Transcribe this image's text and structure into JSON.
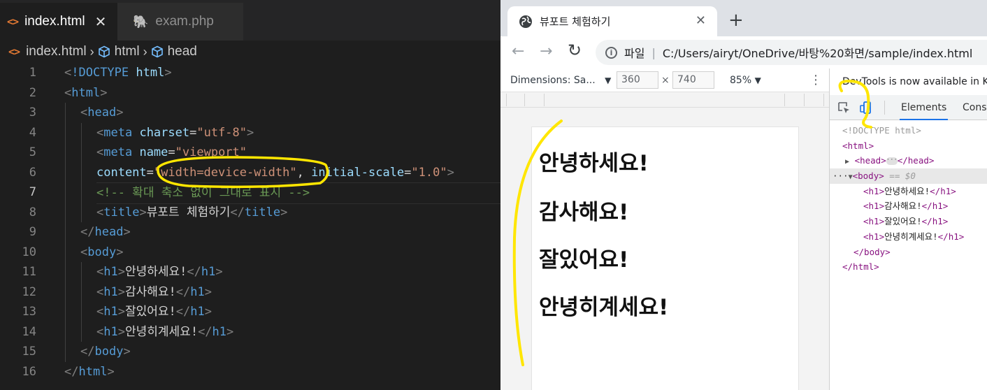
{
  "editor": {
    "tabs": [
      {
        "label": "index.html",
        "close": "✕"
      },
      {
        "label": "exam.php"
      }
    ],
    "breadcrumb": [
      "index.html",
      "html",
      "head"
    ],
    "line_numbers": [
      "1",
      "2",
      "3",
      "4",
      "5",
      "6",
      "7",
      "8",
      "9",
      "10",
      "11",
      "12",
      "13",
      "14",
      "15",
      "16"
    ],
    "lines": {
      "l1_decl": "!DOCTYPE",
      "l1_html": "html",
      "l2": "html",
      "l3": "head",
      "l4_tag": "meta",
      "l4_attr": "charset",
      "l4_val": "\"utf-8\"",
      "l5_tag": "meta",
      "l5_attr": "name",
      "l5_val": "\"viewport\"",
      "l6_attr": "content",
      "l6_val": "\"width=device-width",
      "l6_comma": ", ",
      "l6_rest": "initial-scale=1.0\"",
      "l7": "<!-- 확대 축소 없이 그대로 표시 -->",
      "l8_tag": "title",
      "l8_text": "뷰포트 체험하기",
      "l9": "head",
      "l10": "body",
      "h1_tag": "h1",
      "l11_text": "안녕하세요!",
      "l12_text": "감사해요!",
      "l13_text": "잘있어요!",
      "l14_text": "안녕히계세요!",
      "l15": "body",
      "l16": "html"
    }
  },
  "browser": {
    "tab_title": "뷰포트 체험하기",
    "tab_close": "✕",
    "new_tab": "+",
    "back": "←",
    "forward": "→",
    "reload": "↻",
    "url_scheme": "파일",
    "url_separator": "|",
    "url": "C:/Users/airyt/OneDrive/바탕%20화면/sample/index.html",
    "device_toolbar": {
      "dimensions_label": "Dimensions: Sa...",
      "width": "360",
      "times": "×",
      "height": "740",
      "zoom": "85%",
      "dropdown": "▼",
      "more": "⋮"
    },
    "viewport_headings": [
      "안녕하세요!",
      "감사해요!",
      "잘있어요!",
      "안녕히계세요!"
    ]
  },
  "devtools": {
    "notice": "DevTools is now available in K",
    "tabs": {
      "elements": "Elements",
      "console": "Conso"
    },
    "dom": {
      "doctype": "<!DOCTYPE html>",
      "html_open": "<html>",
      "head_open": "<head>",
      "head_close": "</head>",
      "body_open": "<body>",
      "body_marker": "== $0",
      "row_dots": "···",
      "h1_open": "<h1>",
      "h1_close": "</h1>",
      "h1_texts": [
        "안녕하세요!",
        "감사해요!",
        "잘있어요!",
        "안녕히계세요!"
      ],
      "body_close": "</body>",
      "html_close": "</html>"
    }
  },
  "colors": {
    "annotation": "#ffe600",
    "vscode_bg": "#1e1e1e",
    "tag_blue": "#569cd6",
    "string_orange": "#ce9178",
    "comment_green": "#6a9955",
    "devtools_tag": "#881280",
    "chrome_accent": "#1a73e8"
  }
}
